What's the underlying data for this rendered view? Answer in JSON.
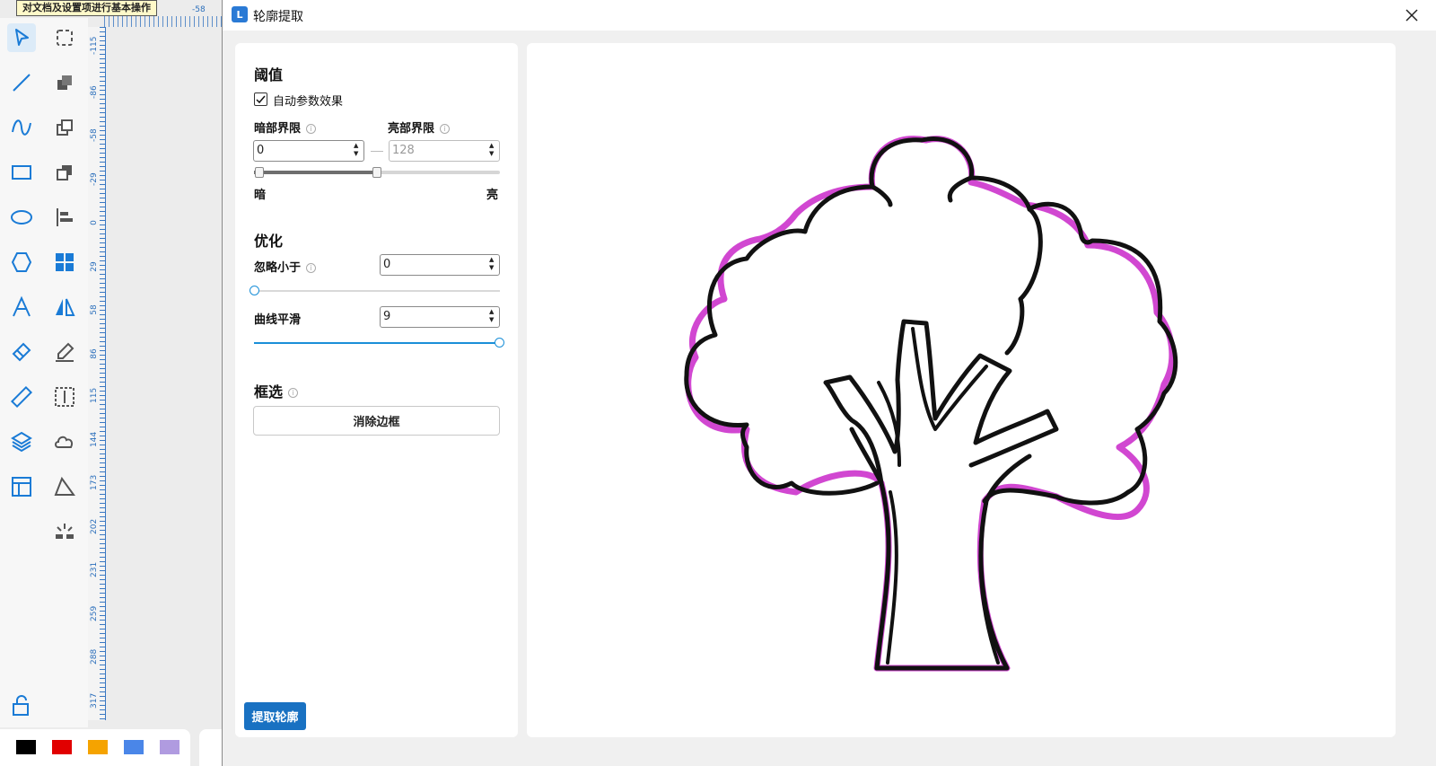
{
  "background_app": {
    "tooltip": "对文档及设置项进行基本操作",
    "top_ruler_label": "-58",
    "left_ruler_labels": [
      "-115",
      "-86",
      "-58",
      "-29",
      "0",
      "29",
      "58",
      "86",
      "115",
      "144",
      "173",
      "202",
      "231",
      "259",
      "288",
      "317"
    ],
    "tools": [
      "select-arrow-icon",
      "crop-frame-icon",
      "line-icon",
      "shape-combine-icon",
      "curve-icon",
      "layer-front-icon",
      "rectangle-icon",
      "layer-back-icon",
      "ellipse-icon",
      "align-left-icon",
      "hexagon-icon",
      "grid-icon",
      "text-icon",
      "mirror-icon",
      "eraser-icon",
      "pen-edit-icon",
      "ruler-icon",
      "distribute-icon",
      "layers-icon",
      "cloud-icon",
      "layout-icon",
      "trace-icon",
      "spark-icon"
    ],
    "swatch_colors": [
      "#000000",
      "#e10000",
      "#f5a300",
      "#4a86e8",
      "#b09be0"
    ]
  },
  "dialog": {
    "title": "轮廓提取",
    "app_icon_letter": "L",
    "threshold": {
      "section_title": "阈值",
      "auto_label": "自动参数效果",
      "auto_checked": true,
      "dark_limit_label": "暗部界限",
      "bright_limit_label": "亮部界限",
      "dark_value": "0",
      "bright_value": "128",
      "range_fraction": [
        0.0,
        0.5
      ],
      "dark_end_label": "暗",
      "bright_end_label": "亮"
    },
    "optimize": {
      "section_title": "优化",
      "ignore_label": "忽略小于",
      "ignore_value": "0",
      "ignore_fraction": 0.0,
      "smooth_label": "曲线平滑",
      "smooth_value": "9",
      "smooth_fraction": 1.0
    },
    "frame_select": {
      "section_title": "框选",
      "remove_border_label": "消除边框"
    },
    "extract_button": "提取轮廓",
    "colors": {
      "primary": "#1971c2",
      "slider_accent": "#1a8fd8",
      "contour_highlight": "#cc33cc"
    }
  }
}
